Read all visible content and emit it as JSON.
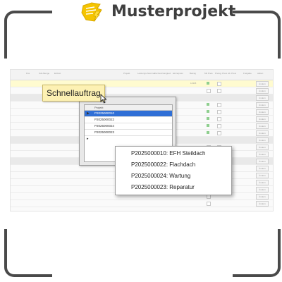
{
  "brand": {
    "name": "Musterprojekt",
    "icon": "document-bolt-icon",
    "accent": "#f5c400"
  },
  "tooltip": {
    "label": "Schnellauftrag"
  },
  "dialog": {
    "title": "Schnellau",
    "column_header": "Projekt",
    "rows": [
      "P2025000010",
      "P2025000022",
      "P2025000024",
      "P2025000023"
    ],
    "selected_index": 0
  },
  "popup": {
    "items": [
      "P2025000010: EFH Steildach",
      "P2025000022: Flachdach",
      "P2025000024: Wartung",
      "P2025000023: Reparatur"
    ]
  },
  "grid": {
    "headers": [
      "Pos",
      "Soll-Menge",
      "Einheit",
      "Projekt",
      "Leistungs-Nummer",
      "Kurztext/Langtext",
      "Einzelpreis",
      "Betrag",
      "Mit Preis",
      "Preisg. Preis",
      "Alt. Preis",
      "Freigabe",
      "Aktion"
    ],
    "highlight_value": "12345",
    "row_button": "Ändern"
  },
  "colors": {
    "selection": "#2f6fd6",
    "tooltip_bg": "#fdf1b3",
    "highlight_row": "#fffbd0"
  }
}
